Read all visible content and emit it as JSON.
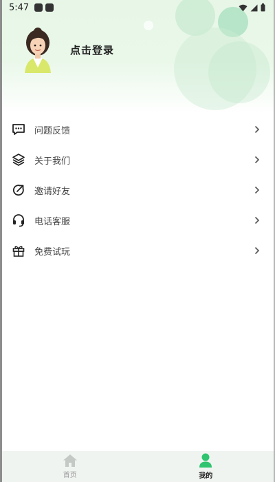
{
  "status_bar": {
    "time": "5:47"
  },
  "profile": {
    "login_label": "点击登录"
  },
  "menu": {
    "items": [
      {
        "label": "问题反馈",
        "icon": "chat-bubble-icon"
      },
      {
        "label": "关于我们",
        "icon": "layers-icon"
      },
      {
        "label": "邀请好友",
        "icon": "share-arrow-icon"
      },
      {
        "label": "电话客服",
        "icon": "headset-icon"
      },
      {
        "label": "免费试玩",
        "icon": "gift-icon"
      }
    ]
  },
  "tabbar": {
    "tabs": [
      {
        "label": "首页",
        "icon": "home-icon",
        "active": false
      },
      {
        "label": "我的",
        "icon": "user-icon",
        "active": true
      }
    ]
  },
  "colors": {
    "accent": "#2fc46f",
    "inactive": "#c5c9c6"
  }
}
